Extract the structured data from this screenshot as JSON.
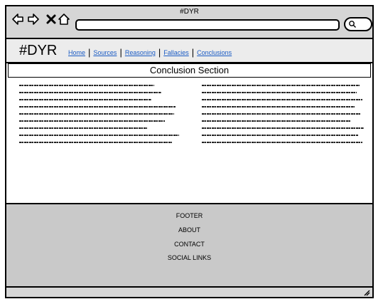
{
  "window": {
    "title": "#DYR"
  },
  "toolbar": {
    "back_icon": "back-arrow-icon",
    "forward_icon": "forward-arrow-icon",
    "close_icon": "close-icon",
    "home_icon": "home-icon",
    "search_icon": "search-icon"
  },
  "nav": {
    "brand": "#DYR",
    "links": [
      "Home",
      "Sources",
      "Reasoning",
      "Fallacies",
      "Conclusions"
    ]
  },
  "main": {
    "section_title": "Conclusion Section"
  },
  "footer": {
    "items": [
      "FOOTER",
      "ABOUT",
      "CONTACT",
      "SOCIAL LINKS"
    ]
  },
  "colors": {
    "link": "#1a5bc4",
    "chrome": "#d6d6d6",
    "footer": "#c9c9c9"
  }
}
